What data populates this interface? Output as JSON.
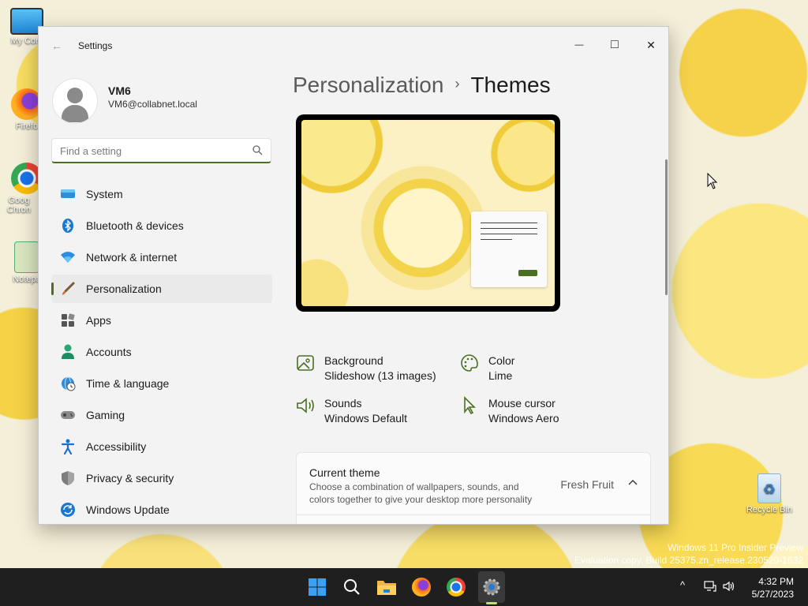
{
  "desktop": {
    "icons": [
      {
        "label": "My Com"
      },
      {
        "label": "Firefo"
      },
      {
        "label": "Goog Chron"
      },
      {
        "label": "Notepa"
      },
      {
        "label": "Recycle Bin"
      }
    ],
    "watermark": {
      "line1": "Windows 11 Pro Insider Preview",
      "line2": "Evaluation copy. Build 25375.zn_release.230520-1632"
    }
  },
  "window": {
    "title": "Settings",
    "controls": {
      "minimize": "—",
      "maximize": "□",
      "close": "✕"
    },
    "user": {
      "name": "VM6",
      "email": "VM6@collabnet.local"
    },
    "search": {
      "placeholder": "Find a setting"
    },
    "nav": [
      {
        "label": "System",
        "icon": "monitor-icon"
      },
      {
        "label": "Bluetooth & devices",
        "icon": "bluetooth-icon"
      },
      {
        "label": "Network & internet",
        "icon": "wifi-icon"
      },
      {
        "label": "Personalization",
        "icon": "brush-icon",
        "active": true
      },
      {
        "label": "Apps",
        "icon": "apps-icon"
      },
      {
        "label": "Accounts",
        "icon": "person-icon"
      },
      {
        "label": "Time & language",
        "icon": "globe-clock-icon"
      },
      {
        "label": "Gaming",
        "icon": "gamepad-icon"
      },
      {
        "label": "Accessibility",
        "icon": "accessibility-icon"
      },
      {
        "label": "Privacy & security",
        "icon": "shield-icon"
      },
      {
        "label": "Windows Update",
        "icon": "update-icon"
      }
    ],
    "breadcrumb": {
      "parent": "Personalization",
      "separator": "›",
      "current": "Themes"
    },
    "properties": {
      "background": {
        "label": "Background",
        "value": "Slideshow (13 images)"
      },
      "color": {
        "label": "Color",
        "value": "Lime"
      },
      "sounds": {
        "label": "Sounds",
        "value": "Windows Default"
      },
      "cursor": {
        "label": "Mouse cursor",
        "value": "Windows Aero"
      }
    },
    "current_theme": {
      "title": "Current theme",
      "description": "Choose a combination of wallpapers, sounds, and colors together to give your desktop more personality",
      "value": "Fresh Fruit"
    }
  },
  "taskbar": {
    "clock": {
      "time": "4:32 PM",
      "date": "5/27/2023"
    },
    "tray": {
      "chevron": "^"
    }
  },
  "colors": {
    "accent": "#4a6f22",
    "taskbar": "#1f1f1f"
  }
}
